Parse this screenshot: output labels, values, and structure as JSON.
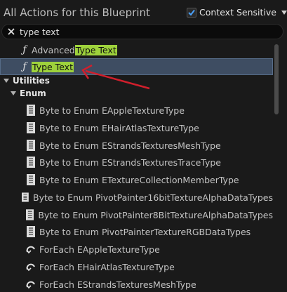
{
  "header": {
    "title": "All Actions for this Blueprint",
    "context_sensitive_label": "Context Sensitive",
    "context_sensitive_checked": true
  },
  "search": {
    "value": "type text",
    "placeholder": ""
  },
  "results": [
    {
      "icon": "function-icon",
      "prefix": "Advanced ",
      "match": "Type Text",
      "suffix": "",
      "selected": false
    },
    {
      "icon": "function-icon",
      "prefix": "",
      "match": "Type Text",
      "suffix": "",
      "selected": true
    }
  ],
  "categories": {
    "utilities": "Utilities",
    "enum": "Enum"
  },
  "enum_items": [
    "Byte to Enum EAppleTextureType",
    "Byte to Enum EHairAtlasTextureType",
    "Byte to Enum EStrandsTexturesMeshType",
    "Byte to Enum EStrandsTexturesTraceType",
    "Byte to Enum ETextureCollectionMemberType",
    "Byte to Enum PivotPainter16bitTextureAlphaDataTypes",
    "Byte to Enum PivotPainter8BitTextureAlphaDataTypes",
    "Byte to Enum PivotPainterTextureRGBDataTypes"
  ],
  "foreach_items": [
    "ForEach EAppleTextureType",
    "ForEach EHairAtlasTextureType",
    "ForEach EStrandsTexturesMeshType"
  ],
  "colors": {
    "highlight": "#9ed23c",
    "selection": "#3e4d62",
    "checkbox_check": "#4aa3ff",
    "annotation_arrow": "#d11f2c"
  }
}
